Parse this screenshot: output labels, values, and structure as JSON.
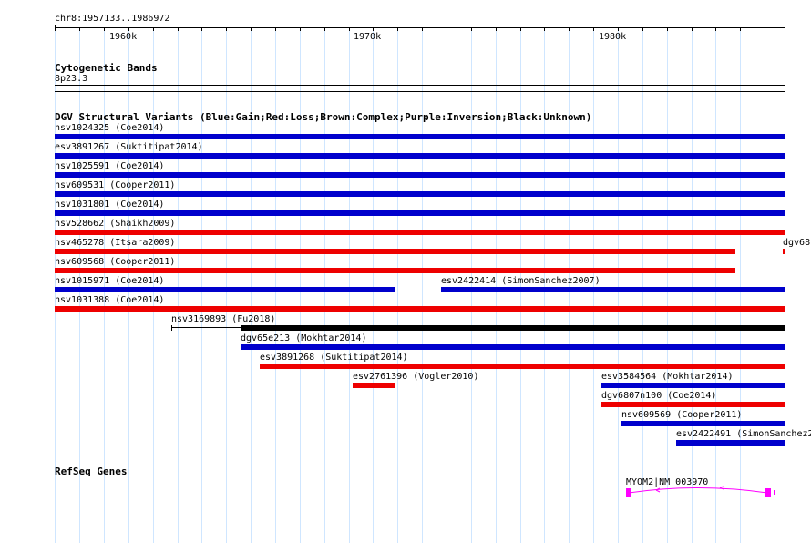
{
  "ruler": {
    "position": "chr8:1957133..1986972",
    "labels": [
      {
        "text": "1960k",
        "bp": 1960000
      },
      {
        "text": "1970k",
        "bp": 1970000
      },
      {
        "text": "1980k",
        "bp": 1980000
      }
    ]
  },
  "cytobands": {
    "title": "Cytogenetic Bands",
    "band": "8p23.3"
  },
  "dgv": {
    "title": "DGV Structural Variants (Blue:Gain;Red:Loss;Brown:Complex;Purple:Inversion;Black:Unknown)",
    "colors": {
      "gain": "#0000cc",
      "loss": "#ee0000",
      "unknown": "#000000"
    },
    "variants": [
      {
        "label": "nsv1024325 (Coe2014)",
        "type": "gain"
      },
      {
        "label": "esv3891267 (Suktitipat2014)",
        "type": "gain"
      },
      {
        "label": "nsv1025591 (Coe2014)",
        "type": "gain"
      },
      {
        "label": "nsv609531 (Cooper2011)",
        "type": "gain"
      },
      {
        "label": "nsv1031801 (Coe2014)",
        "type": "gain"
      },
      {
        "label": "nsv528662 (Shaikh2009)",
        "type": "loss"
      },
      {
        "label": "nsv465278 (Itsara2009)",
        "type": "loss"
      },
      {
        "label": "dgv68",
        "type": "loss"
      },
      {
        "label": "nsv609568 (Cooper2011)",
        "type": "loss"
      },
      {
        "label": "nsv1015971 (Coe2014)",
        "type": "gain"
      },
      {
        "label": "esv2422414 (SimonSanchez2007)",
        "type": "gain"
      },
      {
        "label": "nsv1031388 (Coe2014)",
        "type": "loss"
      },
      {
        "label": "nsv3169893 (Fu2018)",
        "type": "unknown"
      },
      {
        "label": "dgv65e213 (Mokhtar2014)",
        "type": "gain"
      },
      {
        "label": "esv3891268 (Suktitipat2014)",
        "type": "loss"
      },
      {
        "label": "esv2761396 (Vogler2010)",
        "type": "loss"
      },
      {
        "label": "esv3584564 (Mokhtar2014)",
        "type": "gain"
      },
      {
        "label": "dgv6807n100 (Coe2014)",
        "type": "loss"
      },
      {
        "label": "nsv609569 (Cooper2011)",
        "type": "gain"
      },
      {
        "label": "esv2422491 (SimonSanchez2",
        "type": "gain"
      }
    ]
  },
  "refseq": {
    "title": "RefSeq Genes",
    "genes": [
      {
        "label": "MYOM2|NM_003970",
        "color": "#ff00ff"
      }
    ]
  }
}
